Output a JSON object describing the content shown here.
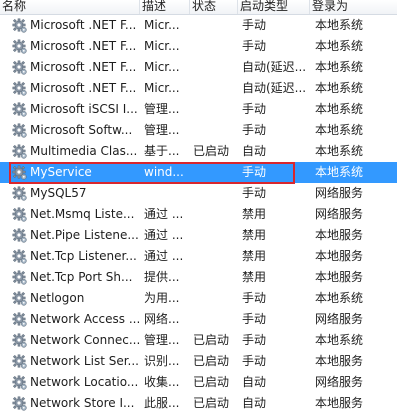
{
  "columns": {
    "name": "名称",
    "description": "描述",
    "status": "状态",
    "startup_type": "启动类型",
    "logon_as": "登录为"
  },
  "services": [
    {
      "name": "Microsoft .NET F...",
      "description": "Micr...",
      "status": "",
      "startup_type": "手动",
      "logon_as": "本地系统"
    },
    {
      "name": "Microsoft .NET F...",
      "description": "Micr...",
      "status": "",
      "startup_type": "手动",
      "logon_as": "本地系统"
    },
    {
      "name": "Microsoft .NET F...",
      "description": "Micr...",
      "status": "",
      "startup_type": "自动(延迟...",
      "logon_as": "本地系统"
    },
    {
      "name": "Microsoft .NET F...",
      "description": "Micr...",
      "status": "",
      "startup_type": "自动(延迟...",
      "logon_as": "本地系统"
    },
    {
      "name": "Microsoft iSCSI I...",
      "description": "管理...",
      "status": "",
      "startup_type": "手动",
      "logon_as": "本地系统"
    },
    {
      "name": "Microsoft Softw...",
      "description": "管理...",
      "status": "",
      "startup_type": "手动",
      "logon_as": "本地系统"
    },
    {
      "name": "Multimedia Clas...",
      "description": "基于...",
      "status": "已启动",
      "startup_type": "自动",
      "logon_as": "本地系统"
    },
    {
      "name": "MyService",
      "description": "wind...",
      "status": "",
      "startup_type": "手动",
      "logon_as": "本地系统",
      "selected": true
    },
    {
      "name": "MySQL57",
      "description": "",
      "status": "",
      "startup_type": "手动",
      "logon_as": "网络服务"
    },
    {
      "name": "Net.Msmq Liste...",
      "description": "通过 ...",
      "status": "",
      "startup_type": "禁用",
      "logon_as": "网络服务"
    },
    {
      "name": "Net.Pipe Listene...",
      "description": "通过 ...",
      "status": "",
      "startup_type": "禁用",
      "logon_as": "本地服务"
    },
    {
      "name": "Net.Tcp Listener...",
      "description": "通过 ...",
      "status": "",
      "startup_type": "禁用",
      "logon_as": "本地服务"
    },
    {
      "name": "Net.Tcp Port Sh...",
      "description": "提供...",
      "status": "",
      "startup_type": "禁用",
      "logon_as": "本地服务"
    },
    {
      "name": "Netlogon",
      "description": "为用...",
      "status": "",
      "startup_type": "手动",
      "logon_as": "本地系统"
    },
    {
      "name": "Network Access ...",
      "description": "网络...",
      "status": "",
      "startup_type": "手动",
      "logon_as": "网络服务"
    },
    {
      "name": "Network Connec...",
      "description": "管理...",
      "status": "已启动",
      "startup_type": "手动",
      "logon_as": "本地系统"
    },
    {
      "name": "Network List Ser...",
      "description": "识别...",
      "status": "已启动",
      "startup_type": "手动",
      "logon_as": "本地服务"
    },
    {
      "name": "Network Locatio...",
      "description": "收集...",
      "status": "已启动",
      "startup_type": "自动",
      "logon_as": "网络服务"
    },
    {
      "name": "Network Store I...",
      "description": "此服...",
      "status": "已启动",
      "startup_type": "自动",
      "logon_as": "本地服务"
    }
  ],
  "colors": {
    "selection": "#3399ff",
    "highlight_outline": "#d9272e"
  }
}
